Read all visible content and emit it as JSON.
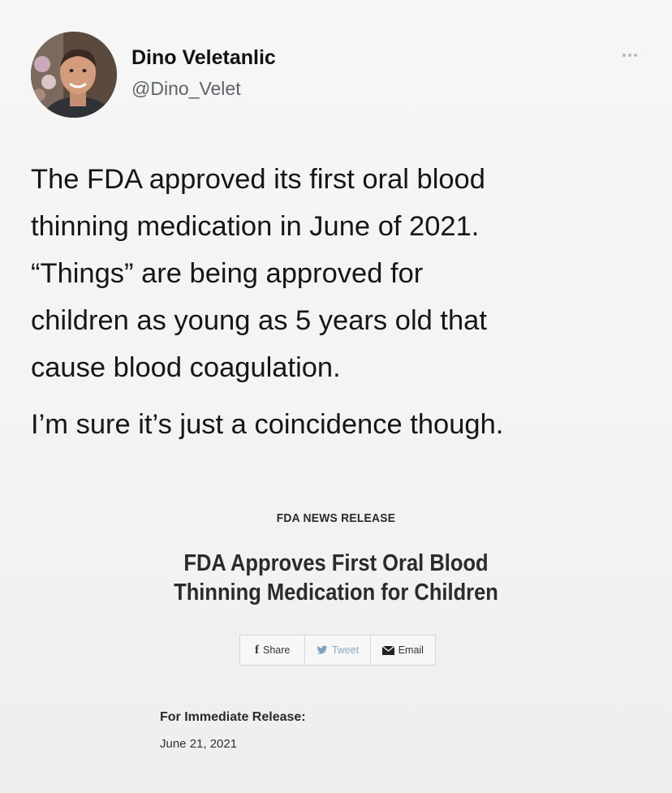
{
  "tweet": {
    "author": {
      "name": "Dino Veletanlic",
      "handle": "@Dino_Velet",
      "avatar_icon": "profile-photo"
    },
    "more_icon": "more-options-icon",
    "text_lines": [
      "The FDA approved its first oral blood",
      "thinning medication in June of 2021.",
      "“Things” are being approved for",
      "children as young as 5 years old that",
      "cause blood coagulation."
    ],
    "text_line_final": "I’m sure it’s just a coincidence though."
  },
  "fda": {
    "kicker": "FDA NEWS RELEASE",
    "headline_lines": [
      "FDA Approves First Oral Blood",
      "Thinning Medication for Children"
    ],
    "share": {
      "share_label": "Share",
      "tweet_label": "Tweet",
      "email_label": "Email",
      "share_icon": "facebook-icon",
      "tweet_icon": "twitter-bird-icon",
      "email_icon": "envelope-icon",
      "tweet_color": "#8aa6c0"
    },
    "release_label": "For Immediate Release:",
    "release_date": "June 21, 2021"
  }
}
